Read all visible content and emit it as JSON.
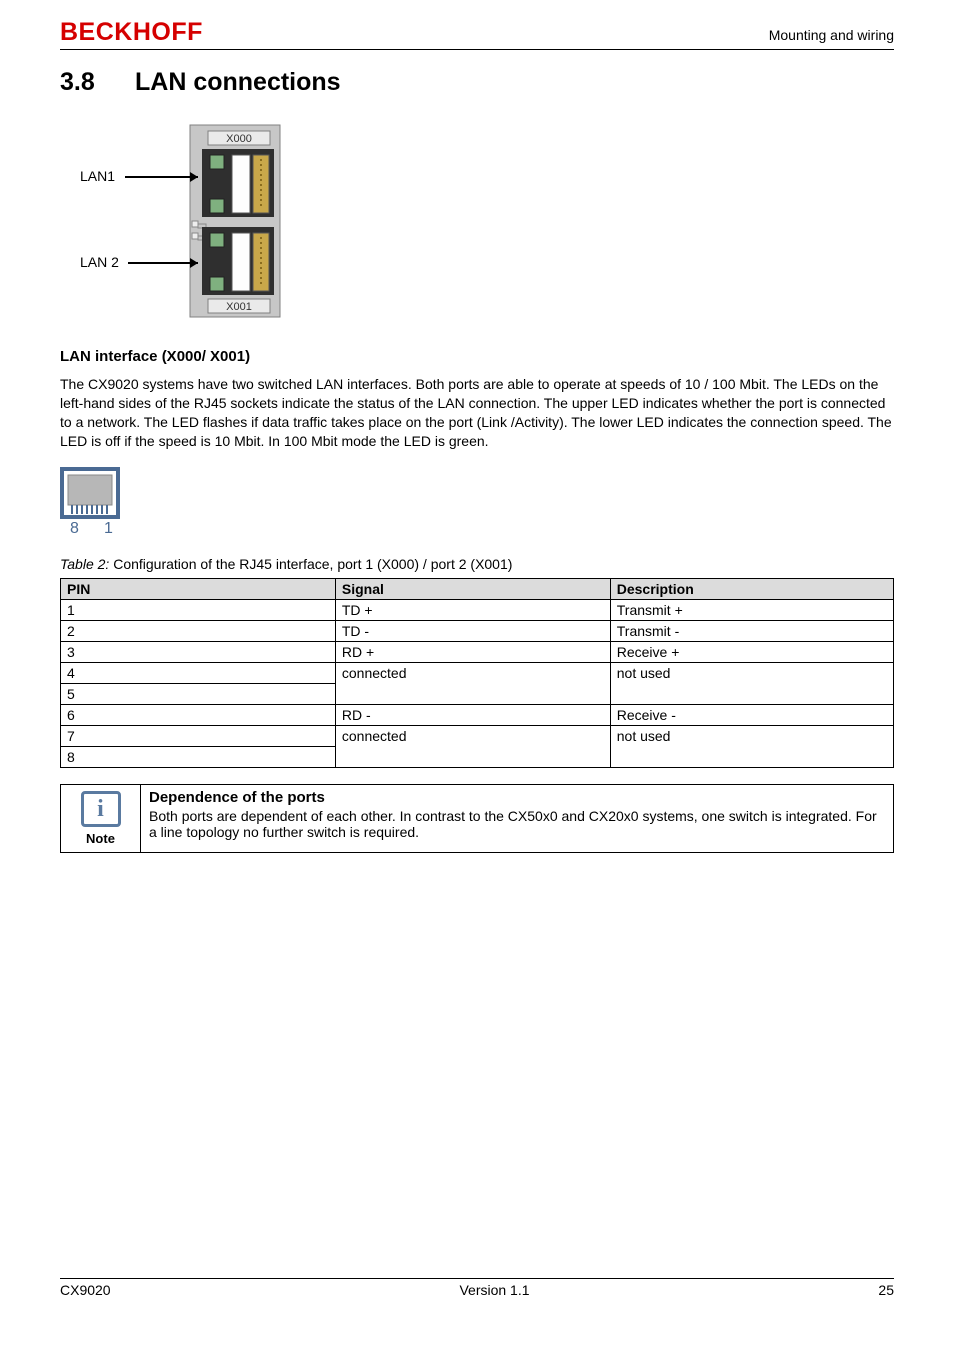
{
  "header": {
    "brand": "BECKHOFF",
    "right": "Mounting and wiring"
  },
  "section": {
    "number": "3.8",
    "title": "LAN connections"
  },
  "lan_labels": {
    "lan1": "LAN1",
    "lan2": "LAN 2",
    "x000": "X000",
    "x001": "X001"
  },
  "subheading": "LAN interface (X000/ X001)",
  "body_paragraph": "The CX9020 systems have two switched LAN interfaces. Both ports are able to operate at speeds of 10 / 100 Mbit. The LEDs on the left-hand sides of the RJ45 sockets indicate the status of the LAN connection. The upper LED indicates whether the port is connected to a network. The LED flashes if data traffic takes place on the port (Link /Activity). The lower LED indicates the connection speed. The LED is off if the speed is 10 Mbit. In 100 Mbit mode the LED is green.",
  "rj45_labels": {
    "left": "8",
    "right": "1"
  },
  "table_caption_prefix": "Table 2:",
  "table_caption_text": " Configuration of the RJ45 interface, port 1 (X000) / port 2 (X001)",
  "table": {
    "headers": [
      "PIN",
      "Signal",
      "Description"
    ],
    "rows": [
      {
        "pin": "1",
        "signal": "TD +",
        "desc": "Transmit +"
      },
      {
        "pin": "2",
        "signal": "TD -",
        "desc": "Transmit -"
      },
      {
        "pin": "3",
        "signal": "RD +",
        "desc": "Receive +"
      },
      {
        "pin": "4",
        "signal": "connected",
        "desc": "not used",
        "rowspan": 2
      },
      {
        "pin": "5"
      },
      {
        "pin": "6",
        "signal": "RD -",
        "desc": "Receive -"
      },
      {
        "pin": "7",
        "signal": "connected",
        "desc": "not used",
        "rowspan": 2
      },
      {
        "pin": "8"
      }
    ]
  },
  "note": {
    "icon_glyph": "i",
    "label": "Note",
    "title": "Dependence of the ports",
    "body": "Both ports are dependent of each other. In contrast to the CX50x0 and CX20x0 systems, one switch is integrated. For a line topology no further switch is required."
  },
  "footer": {
    "left": "CX9020",
    "center": "Version 1.1",
    "right": "25"
  }
}
